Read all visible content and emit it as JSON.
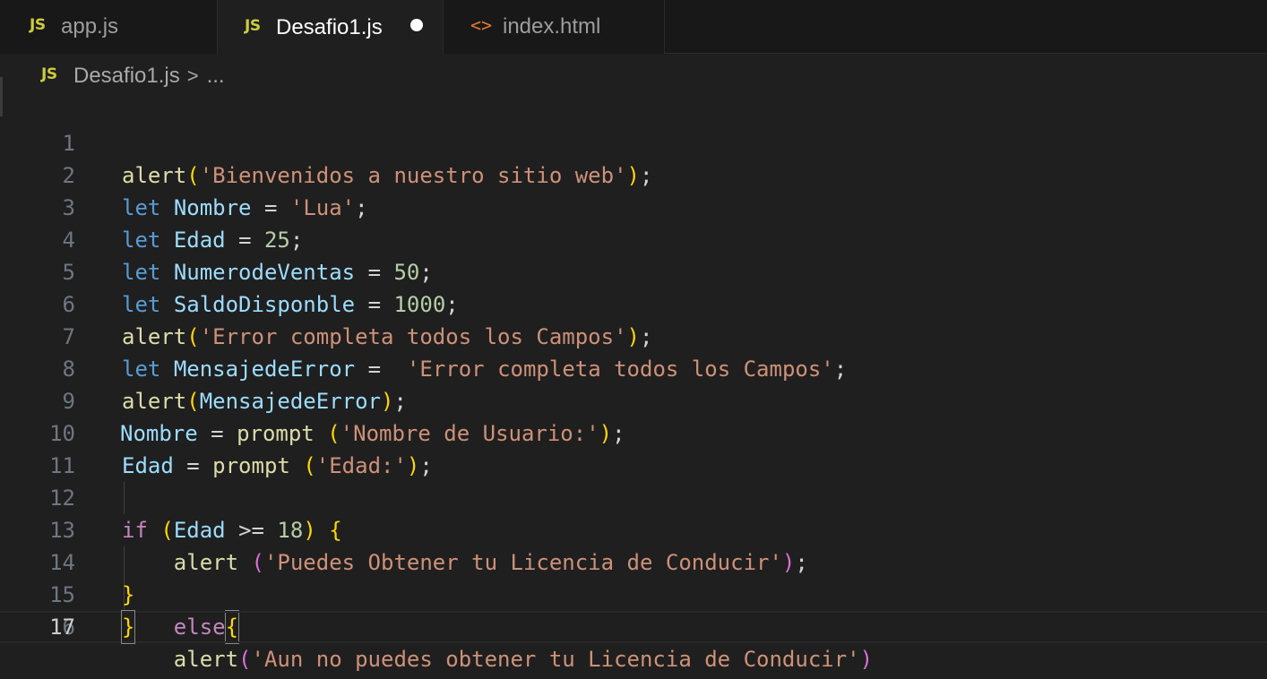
{
  "tabs": [
    {
      "label": "app.js",
      "icon": "JS",
      "icon_name": "javascript-file-icon"
    },
    {
      "label": "Desafio1.js",
      "icon": "JS",
      "icon_name": "javascript-file-icon",
      "active": true,
      "modified": true
    },
    {
      "label": "index.html",
      "icon": "<>",
      "icon_name": "html-file-icon"
    }
  ],
  "breadcrumb": {
    "icon": "JS",
    "file": "Desafio1.js",
    "separator": ">",
    "rest": "..."
  },
  "editor": {
    "current_line": 17,
    "lines": [
      {
        "n": "1",
        "text": "alert('Bienvenidos a nuestro sitio web');"
      },
      {
        "n": "2",
        "text": "let Nombre = 'Lua';"
      },
      {
        "n": "3",
        "text": "let Edad = 25;"
      },
      {
        "n": "4",
        "text": "let NumerodeVentas = 50;"
      },
      {
        "n": "5",
        "text": "let SaldoDisponble = 1000;"
      },
      {
        "n": "6",
        "text": "alert('Error completa todos los Campos');"
      },
      {
        "n": "7",
        "text": "let MensajedeError =  'Error completa todos los Campos';"
      },
      {
        "n": "8",
        "text": "alert(MensajedeError);"
      },
      {
        "n": "9",
        "text": "Nombre = prompt ('Nombre de Usuario:');"
      },
      {
        "n": "10",
        "text": "Edad = prompt ('Edad:');"
      },
      {
        "n": "11",
        "text": ""
      },
      {
        "n": "12",
        "text": "if (Edad >= 18) {"
      },
      {
        "n": "13",
        "text": "    alert ('Puedes Obtener tu Licencia de Conducir');"
      },
      {
        "n": "14",
        "text": "}"
      },
      {
        "n": "15",
        "text": "    else{"
      },
      {
        "n": "16",
        "text": "    alert('Aun no puedes obtener tu Licencia de Conducir')"
      },
      {
        "n": "17",
        "text": "}"
      }
    ]
  },
  "colors": {
    "background": "#1f1f1f",
    "tabbar": "#181818",
    "js_icon": "#cbcb41",
    "html_icon": "#e37933",
    "function": "#dcdcaa",
    "keyword": "#569cd6",
    "control": "#c586c0",
    "variable": "#9cdcfe",
    "string": "#ce9178",
    "number": "#b5cea8",
    "bracket_level1": "#ffd700",
    "bracket_level2": "#da70d6"
  }
}
